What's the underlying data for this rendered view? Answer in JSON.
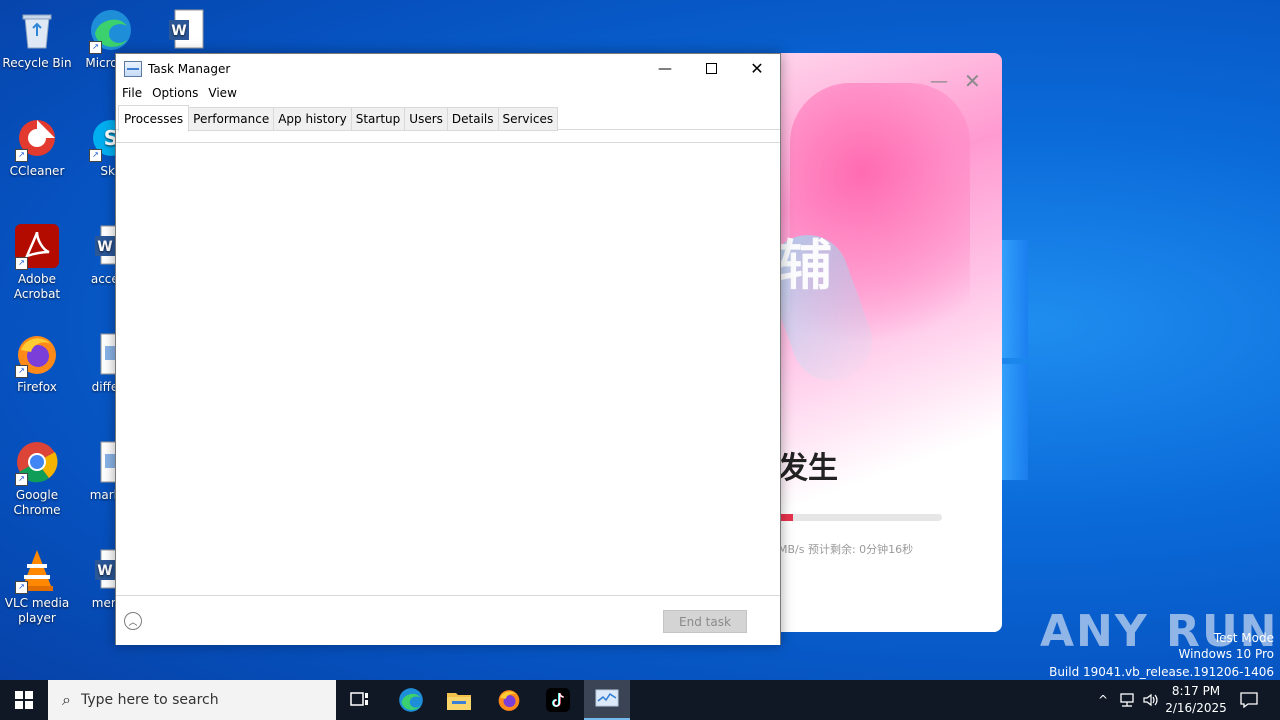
{
  "desktop": {
    "icons": [
      {
        "label": "Recycle Bin"
      },
      {
        "label": "Micro Ed"
      },
      {
        "label": "CCleaner"
      },
      {
        "label": "Sky"
      },
      {
        "label": "Adobe Acrobat"
      },
      {
        "label": "accept"
      },
      {
        "label": "Firefox"
      },
      {
        "label": "differe"
      },
      {
        "label": "Google Chrome"
      },
      {
        "label": "market"
      },
      {
        "label": "VLC media player"
      },
      {
        "label": "memb"
      }
    ]
  },
  "background_app": {
    "big_char": "辅",
    "headline": "发生",
    "progress_fraction": 0.1,
    "status_text": "MB/s 预计剩余: 0分钟16秒",
    "accent_color": "#e8324d"
  },
  "task_manager": {
    "title": "Task Manager",
    "menu": [
      "File",
      "Options",
      "View"
    ],
    "tabs": [
      "Processes",
      "Performance",
      "App history",
      "Startup",
      "Users",
      "Details",
      "Services"
    ],
    "active_tab": "Processes",
    "end_task_label": "End task"
  },
  "watermark": {
    "logo": "ANY RUN",
    "line1": "Test Mode",
    "line2": "Windows 10 Pro",
    "line3": "Build 19041.vb_release.191206-1406"
  },
  "taskbar": {
    "search_placeholder": "Type here to search",
    "time": "8:17 PM",
    "date": "2/16/2025"
  }
}
